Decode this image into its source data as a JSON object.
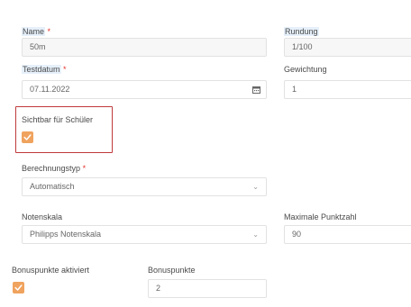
{
  "form": {
    "name": {
      "label": "Name",
      "required": "*",
      "value": "50m"
    },
    "rundung": {
      "label": "Rundung",
      "value": "1/100"
    },
    "testdatum": {
      "label": "Testdatum",
      "required": "*",
      "value": "07.11.2022",
      "icon": "calendar-icon"
    },
    "gewichtung": {
      "label": "Gewichtung",
      "value": "1"
    },
    "sichtbar": {
      "label": "Sichtbar für Schüler",
      "checked": true
    },
    "berechnungstyp": {
      "label": "Berechnungstyp",
      "required": "*",
      "value": "Automatisch",
      "icon": "chevron-down-icon"
    },
    "notenskala": {
      "label": "Notenskala",
      "value": "Philipps Notenskala",
      "icon": "chevron-down-icon"
    },
    "maximale_punktzahl": {
      "label": "Maximale Punktzahl",
      "value": "90"
    },
    "bonuspunkte_aktiviert": {
      "label": "Bonuspunkte aktiviert",
      "checked": true
    },
    "bonuspunkte": {
      "label": "Bonuspunkte",
      "value": "2"
    }
  },
  "colors": {
    "checkbox": "#f0a35e",
    "highlight_border": "#c0393b",
    "required": "#e3342f"
  }
}
